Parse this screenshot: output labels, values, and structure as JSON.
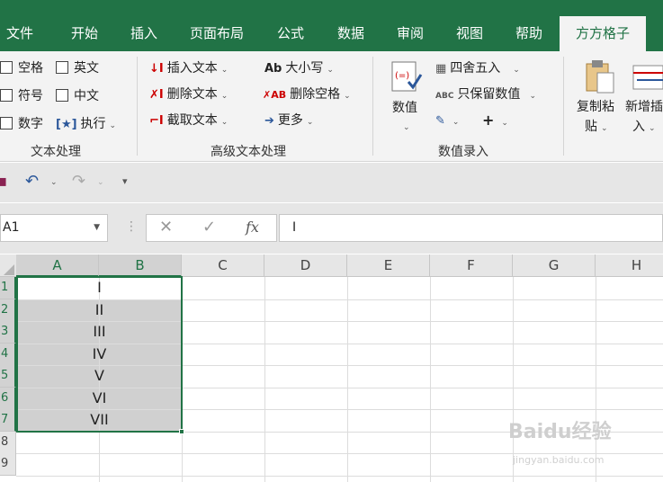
{
  "tabs": [
    {
      "label": "文件"
    },
    {
      "label": "开始"
    },
    {
      "label": "插入"
    },
    {
      "label": "页面布局"
    },
    {
      "label": "公式"
    },
    {
      "label": "数据"
    },
    {
      "label": "审阅"
    },
    {
      "label": "视图"
    },
    {
      "label": "帮助"
    },
    {
      "label": "方方格子"
    }
  ],
  "ribbon": {
    "text_group": {
      "items": [
        "空格",
        "英文",
        "符号",
        "中文",
        "数字",
        "执行"
      ],
      "label": "文本处理"
    },
    "adv_group": {
      "items": [
        "插入文本",
        "大小写",
        "删除文本",
        "删除空格",
        "截取文本",
        "更多"
      ],
      "label": "高级文本处理"
    },
    "num_group": {
      "value_label": "数值",
      "round_label": "四舍五入",
      "keep_label": "只保留数值",
      "abc_prefix": "ABC",
      "label": "数值录入"
    },
    "copy_paste_label": [
      "复制粘",
      "贴"
    ],
    "new_insert_label": [
      "新增插",
      "入"
    ]
  },
  "formula_bar": {
    "name_box": "A1",
    "cancel_glyph": "✕",
    "enter_glyph": "✓",
    "fx": "fx",
    "value": "I"
  },
  "columns": [
    "A",
    "B",
    "C",
    "D",
    "E",
    "F",
    "G",
    "H"
  ],
  "rows": [
    "1",
    "2",
    "3",
    "4",
    "5",
    "6",
    "7",
    "8",
    "9"
  ],
  "cells": [
    "I",
    "II",
    "III",
    "IV",
    "V",
    "VI",
    "VII"
  ],
  "watermark": {
    "brand": "Baidu经验",
    "url": "jingyan.baidu.com"
  },
  "colors": {
    "accent": "#217346",
    "selection": "#d0d0d0"
  }
}
